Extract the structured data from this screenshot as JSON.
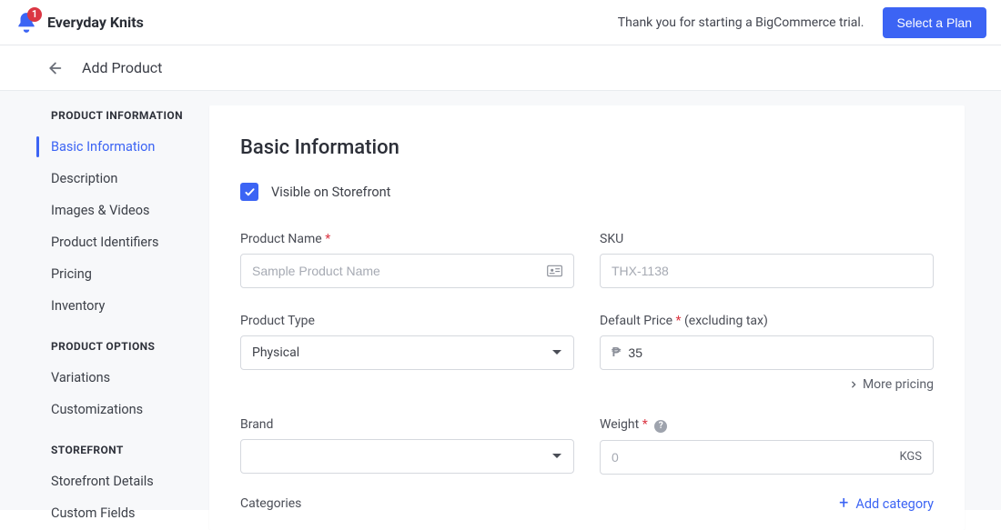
{
  "header": {
    "notifications_count": "1",
    "store_name": "Everyday Knits",
    "trial_message": "Thank you for starting a BigCommerce trial.",
    "select_plan_label": "Select a Plan"
  },
  "subheader": {
    "title": "Add Product"
  },
  "sidebar": {
    "groups": [
      {
        "label": "PRODUCT INFORMATION",
        "items": [
          {
            "label": "Basic Information",
            "active": true
          },
          {
            "label": "Description"
          },
          {
            "label": "Images & Videos"
          },
          {
            "label": "Product Identifiers"
          },
          {
            "label": "Pricing"
          },
          {
            "label": "Inventory"
          }
        ]
      },
      {
        "label": "PRODUCT OPTIONS",
        "items": [
          {
            "label": "Variations"
          },
          {
            "label": "Customizations"
          }
        ]
      },
      {
        "label": "STOREFRONT",
        "items": [
          {
            "label": "Storefront Details"
          },
          {
            "label": "Custom Fields"
          }
        ]
      }
    ]
  },
  "main": {
    "title": "Basic Information",
    "visible_label": "Visible on Storefront",
    "visible_checked": true,
    "product_name": {
      "label": "Product Name",
      "required": "*",
      "placeholder": "Sample Product Name",
      "value": ""
    },
    "sku": {
      "label": "SKU",
      "placeholder": "THX-1138",
      "value": ""
    },
    "product_type": {
      "label": "Product Type",
      "value": "Physical"
    },
    "default_price": {
      "label": "Default Price",
      "required": "*",
      "hint": "(excluding tax)",
      "currency": "₱",
      "value": "35"
    },
    "more_pricing_label": "More pricing",
    "brand": {
      "label": "Brand",
      "value": ""
    },
    "weight": {
      "label": "Weight",
      "required": "*",
      "placeholder": "0",
      "unit": "KGS",
      "value": ""
    },
    "categories_label": "Categories",
    "add_category_label": "Add category"
  }
}
